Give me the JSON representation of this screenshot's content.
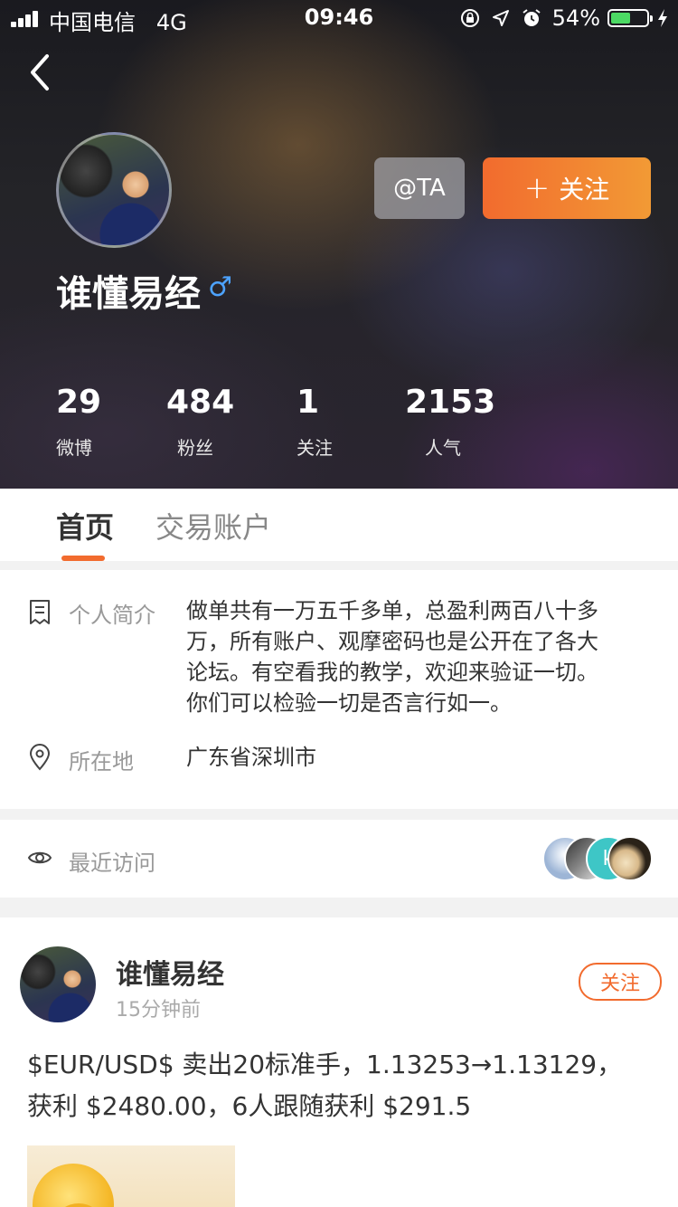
{
  "status_bar": {
    "carrier": "中国电信",
    "network": "4G",
    "time": "09:46",
    "battery_percent": "54%",
    "battery_level": 0.54,
    "icons": [
      "signal-icon",
      "lock-rotation-icon",
      "location-icon",
      "alarm-icon",
      "battery-icon",
      "charging-icon"
    ]
  },
  "profile": {
    "name": "谁懂易经",
    "gender_symbol": "♂",
    "at_button": "@TA",
    "follow_button": "关注",
    "follow_plus": "+",
    "stats": [
      {
        "value": "29",
        "label": "微博"
      },
      {
        "value": "484",
        "label": "粉丝"
      },
      {
        "value": "1",
        "label": "关注"
      },
      {
        "value": "2153",
        "label": "人气"
      }
    ]
  },
  "tabs": [
    {
      "label": "首页",
      "active": true
    },
    {
      "label": "交易账户",
      "active": false
    }
  ],
  "info": {
    "bio_label": "个人简介",
    "bio_lines": [
      "做单共有一万五千多单，总盈利两百八十多",
      "万，所有账户、观摩密码也是公开在了各大",
      "论坛。有空看我的教学，欢迎来验证一切。",
      "你们可以检验一切是否言行如一。"
    ],
    "location_label": "所在地",
    "location_value": "广东省深圳市"
  },
  "recent_visits": {
    "label": "最近访问",
    "visitor_initial": "k"
  },
  "post": {
    "author": "谁懂易经",
    "time": "15分钟前",
    "follow_label": "关注",
    "text_lines": [
      "$EUR/USD$ 卖出20标准手，1.13253→1.13129，",
      "获利 $2480.00，6人跟随获利 $291.5"
    ]
  },
  "colors": {
    "accent": "#f26b2e",
    "accent_light": "#f29a35",
    "gender_blue": "#4da3ff",
    "battery_green": "#4cd964"
  }
}
